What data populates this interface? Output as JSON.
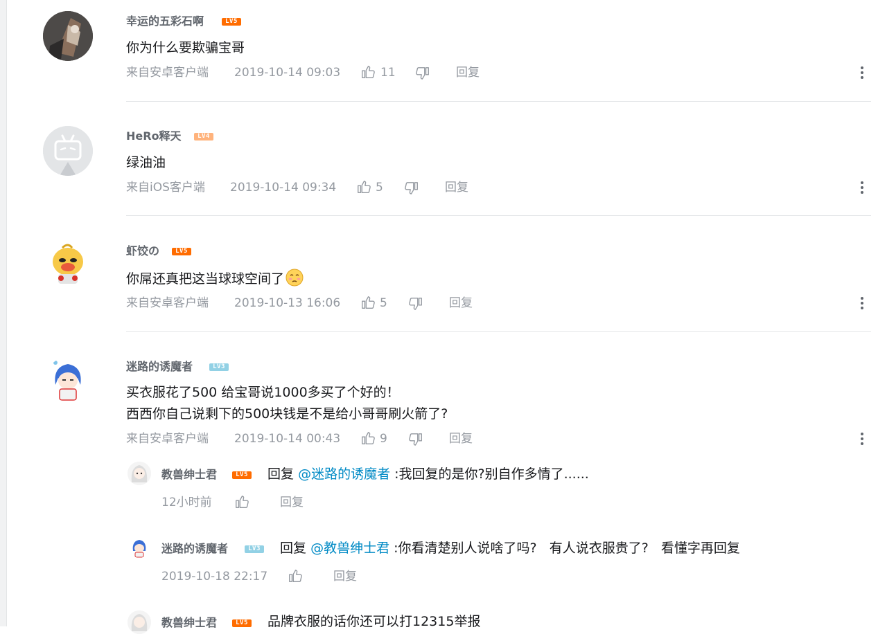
{
  "comments": [
    {
      "user": "幸运的五彩石啊",
      "level": "LV5",
      "text": "你为什么要欺骗宝哥",
      "source": "来自安卓客户端",
      "time": "2019-10-14 09:03",
      "likes": "11",
      "reply": "回复"
    },
    {
      "user": "HeRo释天",
      "level": "LV4",
      "text": "绿油油",
      "source": "来自iOS客户端",
      "time": "2019-10-14 09:34",
      "likes": "5",
      "reply": "回复"
    },
    {
      "user": "虾饺の",
      "level": "LV5",
      "text": "你屌还真把这当球球空间了",
      "source": "来自安卓客户端",
      "time": "2019-10-13 16:06",
      "likes": "5",
      "reply": "回复"
    },
    {
      "user": "迷路的诱魔者",
      "level": "LV3",
      "text_line1": "买衣服花了500 给宝哥说1000多买了个好的！",
      "text_line2": "西西你自己说剩下的500块钱是不是给小哥哥刷火箭了?",
      "source": "来自安卓客户端",
      "time": "2019-10-14 00:43",
      "likes": "9",
      "reply": "回复"
    }
  ],
  "subreplies": [
    {
      "user": "教兽绅士君",
      "level": "LV5",
      "reply_word": "回复",
      "mention": "@迷路的诱魔者",
      "text": " :我回复的是你?别自作多情了......",
      "time": "12小时前",
      "reply": "回复"
    },
    {
      "user": "迷路的诱魔者",
      "level": "LV3",
      "reply_word": "回复",
      "mention": "@教兽绅士君",
      "text": " :你看清楚别人说啥了吗?   有人说衣服贵了?   看懂字再回复",
      "time": "2019-10-18 22:17",
      "reply": "回复"
    },
    {
      "user": "教兽绅士君",
      "level": "LV5",
      "text": "品牌衣服的话你还可以打12315举报"
    }
  ],
  "colors": {
    "accent_link": "#008ac5",
    "lv5": "#ff6c00",
    "lv4": "#ffb37c",
    "lv3": "#92d1e5",
    "meta_gray": "#9499a0"
  }
}
